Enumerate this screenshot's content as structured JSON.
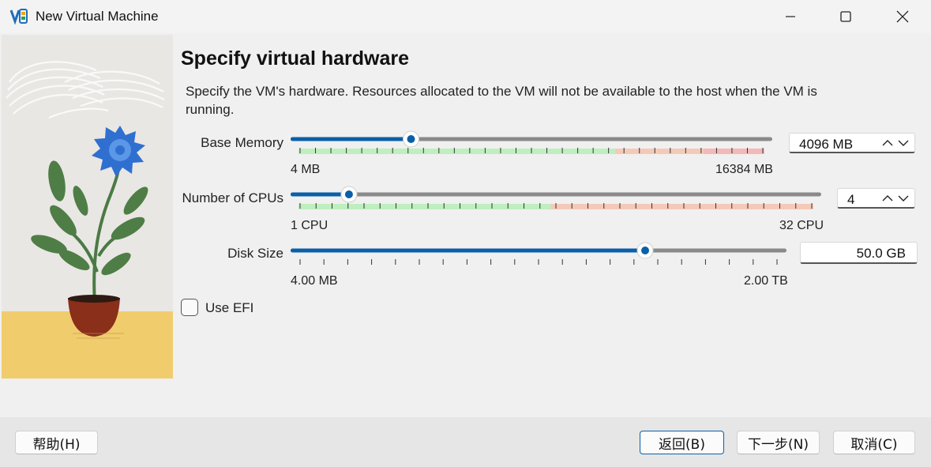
{
  "window": {
    "title": "New Virtual Machine",
    "icon": "virtualbox-icon"
  },
  "page": {
    "title": "Specify virtual hardware",
    "description": "Specify the VM's hardware. Resources allocated to the VM will not be available to the host when the VM is running."
  },
  "base_memory": {
    "label": "Base Memory",
    "value": "4096 MB",
    "min_label": "4 MB",
    "max_label": "16384 MB",
    "fraction": 0.25
  },
  "cpus": {
    "label": "Number of CPUs",
    "value": "4",
    "min_label": "1 CPU",
    "max_label": "32 CPU",
    "fraction": 0.11
  },
  "disk": {
    "label": "Disk Size",
    "value": "50.0 GB",
    "min_label": "4.00 MB",
    "max_label": "2.00 TB",
    "fraction": 0.715
  },
  "use_efi": {
    "label": "Use EFI",
    "checked": false
  },
  "buttons": {
    "help": "帮助(H)",
    "back": "返回(B)",
    "next": "下一步(N)",
    "cancel": "取消(C)"
  },
  "colors": {
    "accent": "#0a5fa8",
    "track": "#8a8a8a",
    "green_zone": "#bfeebf",
    "orange_zone": "#f5c9b8",
    "red_zone": "#f4b8b8"
  }
}
